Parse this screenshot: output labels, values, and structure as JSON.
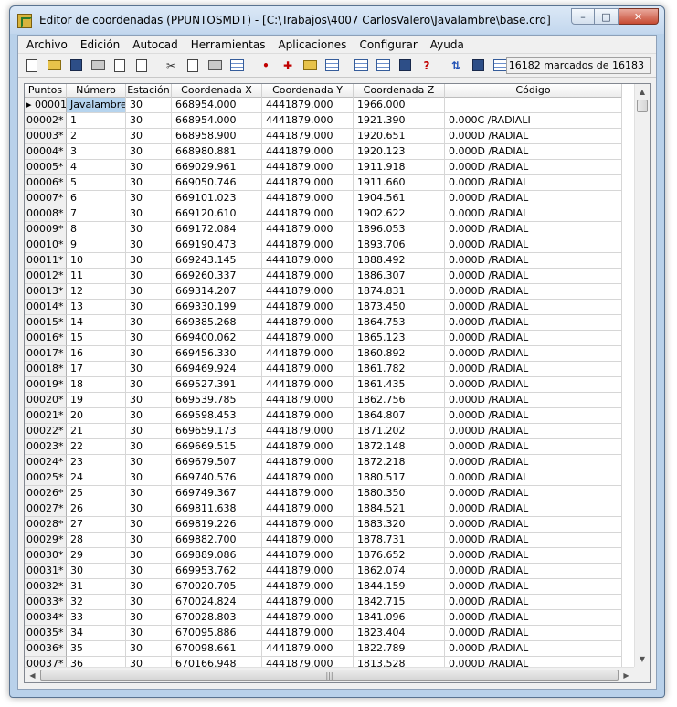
{
  "window": {
    "title": "Editor de coordenadas (PPUNTOSMDT) - [C:\\Trabajos\\4007 CarlosValero\\Javalambre\\base.crd]",
    "minimize": "–",
    "maximize": "□",
    "close": "✕"
  },
  "menu": [
    "Archivo",
    "Edición",
    "Autocad",
    "Herramientas",
    "Aplicaciones",
    "Configurar",
    "Ayuda"
  ],
  "toolbar": {
    "status": "16182 marcados de 16183",
    "icons": [
      "new-icon",
      "open-icon",
      "save-icon",
      "print-icon",
      "export-icon",
      "import-icon",
      "cut-icon",
      "copy-icon",
      "paste-icon",
      "select-icon",
      "point-icon",
      "cross-icon",
      "cod-icon",
      "edit-icon",
      "table-icon",
      "zoom-icon",
      "window-icon",
      "help-icon",
      "sort-icon",
      "mark-icon",
      "screen-icon"
    ]
  },
  "grid": {
    "columns": [
      "Puntos",
      "Número",
      "Estación",
      "Coordenada X",
      "Coordenada Y",
      "Coordenada Z",
      "Código"
    ],
    "rows": [
      [
        "▸ 00001",
        "Javalambre",
        "30",
        "668954.000",
        "4441879.000",
        "1966.000",
        ""
      ],
      [
        "00002*",
        "1",
        "30",
        "668954.000",
        "4441879.000",
        "1921.390",
        "0.000C /RADIALI"
      ],
      [
        "00003*",
        "2",
        "30",
        "668958.900",
        "4441879.000",
        "1920.651",
        "0.000D /RADIAL"
      ],
      [
        "00004*",
        "3",
        "30",
        "668980.881",
        "4441879.000",
        "1920.123",
        "0.000D /RADIAL"
      ],
      [
        "00005*",
        "4",
        "30",
        "669029.961",
        "4441879.000",
        "1911.918",
        "0.000D /RADIAL"
      ],
      [
        "00006*",
        "5",
        "30",
        "669050.746",
        "4441879.000",
        "1911.660",
        "0.000D /RADIAL"
      ],
      [
        "00007*",
        "6",
        "30",
        "669101.023",
        "4441879.000",
        "1904.561",
        "0.000D /RADIAL"
      ],
      [
        "00008*",
        "7",
        "30",
        "669120.610",
        "4441879.000",
        "1902.622",
        "0.000D /RADIAL"
      ],
      [
        "00009*",
        "8",
        "30",
        "669172.084",
        "4441879.000",
        "1896.053",
        "0.000D /RADIAL"
      ],
      [
        "00010*",
        "9",
        "30",
        "669190.473",
        "4441879.000",
        "1893.706",
        "0.000D /RADIAL"
      ],
      [
        "00011*",
        "10",
        "30",
        "669243.145",
        "4441879.000",
        "1888.492",
        "0.000D /RADIAL"
      ],
      [
        "00012*",
        "11",
        "30",
        "669260.337",
        "4441879.000",
        "1886.307",
        "0.000D /RADIAL"
      ],
      [
        "00013*",
        "12",
        "30",
        "669314.207",
        "4441879.000",
        "1874.831",
        "0.000D /RADIAL"
      ],
      [
        "00014*",
        "13",
        "30",
        "669330.199",
        "4441879.000",
        "1873.450",
        "0.000D /RADIAL"
      ],
      [
        "00015*",
        "14",
        "30",
        "669385.268",
        "4441879.000",
        "1864.753",
        "0.000D /RADIAL"
      ],
      [
        "00016*",
        "15",
        "30",
        "669400.062",
        "4441879.000",
        "1865.123",
        "0.000D /RADIAL"
      ],
      [
        "00017*",
        "16",
        "30",
        "669456.330",
        "4441879.000",
        "1860.892",
        "0.000D /RADIAL"
      ],
      [
        "00018*",
        "17",
        "30",
        "669469.924",
        "4441879.000",
        "1861.782",
        "0.000D /RADIAL"
      ],
      [
        "00019*",
        "18",
        "30",
        "669527.391",
        "4441879.000",
        "1861.435",
        "0.000D /RADIAL"
      ],
      [
        "00020*",
        "19",
        "30",
        "669539.785",
        "4441879.000",
        "1862.756",
        "0.000D /RADIAL"
      ],
      [
        "00021*",
        "20",
        "30",
        "669598.453",
        "4441879.000",
        "1864.807",
        "0.000D /RADIAL"
      ],
      [
        "00022*",
        "21",
        "30",
        "669659.173",
        "4441879.000",
        "1871.202",
        "0.000D /RADIAL"
      ],
      [
        "00023*",
        "22",
        "30",
        "669669.515",
        "4441879.000",
        "1872.148",
        "0.000D /RADIAL"
      ],
      [
        "00024*",
        "23",
        "30",
        "669679.507",
        "4441879.000",
        "1872.218",
        "0.000D /RADIAL"
      ],
      [
        "00025*",
        "24",
        "30",
        "669740.576",
        "4441879.000",
        "1880.517",
        "0.000D /RADIAL"
      ],
      [
        "00026*",
        "25",
        "30",
        "669749.367",
        "4441879.000",
        "1880.350",
        "0.000D /RADIAL"
      ],
      [
        "00027*",
        "26",
        "30",
        "669811.638",
        "4441879.000",
        "1884.521",
        "0.000D /RADIAL"
      ],
      [
        "00028*",
        "27",
        "30",
        "669819.226",
        "4441879.000",
        "1883.320",
        "0.000D /RADIAL"
      ],
      [
        "00029*",
        "28",
        "30",
        "669882.700",
        "4441879.000",
        "1878.731",
        "0.000D /RADIAL"
      ],
      [
        "00030*",
        "29",
        "30",
        "669889.086",
        "4441879.000",
        "1876.652",
        "0.000D /RADIAL"
      ],
      [
        "00031*",
        "30",
        "30",
        "669953.762",
        "4441879.000",
        "1862.074",
        "0.000D /RADIAL"
      ],
      [
        "00032*",
        "31",
        "30",
        "670020.705",
        "4441879.000",
        "1844.159",
        "0.000D /RADIAL"
      ],
      [
        "00033*",
        "32",
        "30",
        "670024.824",
        "4441879.000",
        "1842.715",
        "0.000D /RADIAL"
      ],
      [
        "00034*",
        "33",
        "30",
        "670028.803",
        "4441879.000",
        "1841.096",
        "0.000D /RADIAL"
      ],
      [
        "00035*",
        "34",
        "30",
        "670095.886",
        "4441879.000",
        "1823.404",
        "0.000D /RADIAL"
      ],
      [
        "00036*",
        "35",
        "30",
        "670098.661",
        "4441879.000",
        "1822.789",
        "0.000D /RADIAL"
      ],
      [
        "00037*",
        "36",
        "30",
        "670166.948",
        "4441879.000",
        "1813.528",
        "0.000D /RADIAL"
      ]
    ]
  }
}
